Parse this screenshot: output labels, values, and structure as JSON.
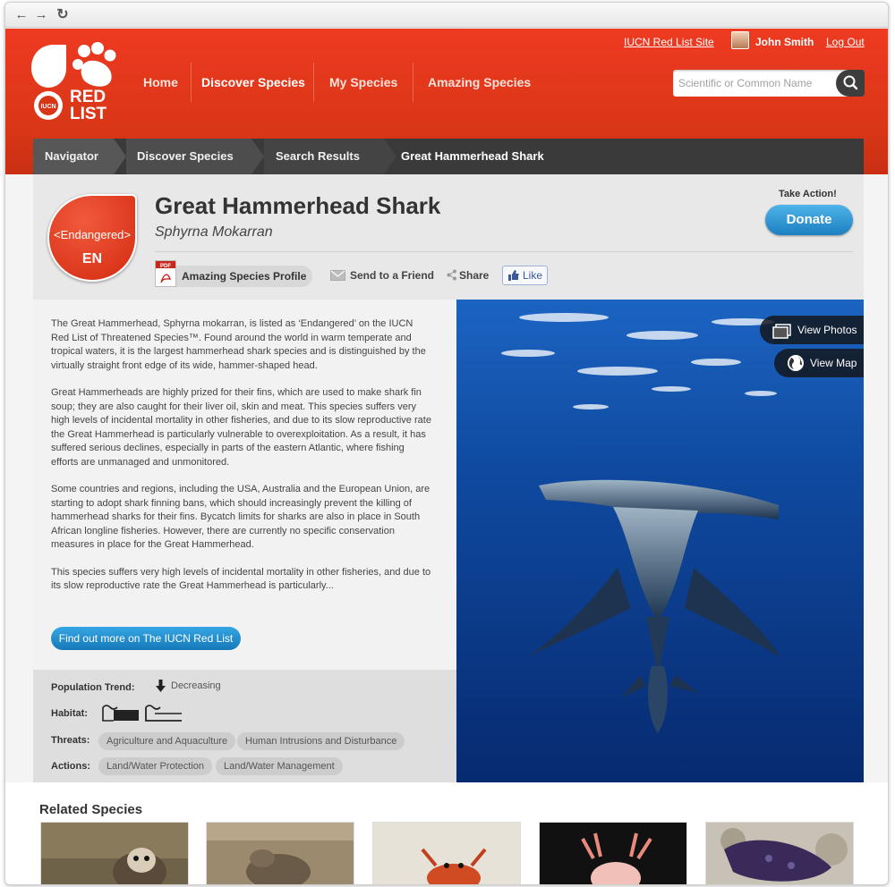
{
  "browser": {
    "back_icon": "arrow-left-icon",
    "forward_icon": "arrow-right-icon",
    "reload_icon": "reload-icon"
  },
  "header": {
    "logo_text_line1": "RED",
    "logo_text_line2": "LIST",
    "logo_seal": "IUCN",
    "nav": [
      {
        "label": "Home"
      },
      {
        "label": "Discover Species"
      },
      {
        "label": "My Species"
      },
      {
        "label": "Amazing Species"
      }
    ],
    "iucn_link": "IUCN Red List Site",
    "user_name": "John Smith",
    "logout": "Log Out",
    "search_placeholder": "Scientific or Common Name"
  },
  "breadcrumbs": [
    {
      "label": "Navigator"
    },
    {
      "label": "Discover Species"
    },
    {
      "label": "Search Results"
    },
    {
      "label": "Great Hammerhead Shark"
    }
  ],
  "species": {
    "status_label": "<Endangered>",
    "status_code": "EN",
    "common_name": "Great Hammerhead Shark",
    "scientific_name": "Sphyrna Mokarran",
    "take_action": "Take Action!",
    "donate": "Donate",
    "profile_button": "Amazing Species Profile",
    "send_friend": "Send to a Friend",
    "share": "Share",
    "like": "Like"
  },
  "description": [
    "The Great Hammerhead, Sphyrna mokarran, is listed as ‘Endangered’ on the IUCN Red List of Threatened Species™. Found around the world in warm temperate and tropical waters, it is the largest hammerhead shark species and is distinguished by the virtually straight front edge of its wide, hammer-shaped head.",
    "Great Hammerheads are highly prized for their fins, which are used to make shark fin soup; they are also caught for their liver oil, skin and meat. This species suffers very high levels of incidental mortality in other fisheries, and due to its slow reproductive rate the Great Hammerhead is particularly vulnerable to overexploitation. As a result, it has suffered serious declines, especially in parts of the eastern Atlantic, where fishing efforts are unmanaged and unmonitored.",
    "Some countries and regions, including the USA, Australia and the European Union, are starting to adopt shark finning bans, which should increasingly prevent the killing of hammerhead sharks for their fins. Bycatch limits for sharks are also in place in South African longline fisheries. However, there are currently no specific conservation measures in place for the Great Hammerhead.",
    "This species suffers very high levels of incidental mortality in other fisheries, and due to its slow reproductive rate the Great Hammerhead is particularly..."
  ],
  "find_more_button": "Find out more on The IUCN Red List",
  "facts": {
    "population_label": "Population Trend:",
    "population_value": "Decreasing",
    "habitat_label": "Habitat:",
    "threats_label": "Threats:",
    "threats": [
      "Agriculture and Aquaculture",
      "Human Intrusions and Disturbance"
    ],
    "actions_label": "Actions:",
    "actions": [
      "Land/Water Protection",
      "Land/Water Management"
    ]
  },
  "photo_buttons": {
    "photos": "View Photos",
    "map": "View Map"
  },
  "related": {
    "title": "Related Species"
  },
  "colors": {
    "brand_red": "#e23a1f",
    "breadcrumb_bg": "#3a3a3a",
    "donate_blue": "#2a8fd0",
    "ocean_blue": "#0d3a86"
  }
}
